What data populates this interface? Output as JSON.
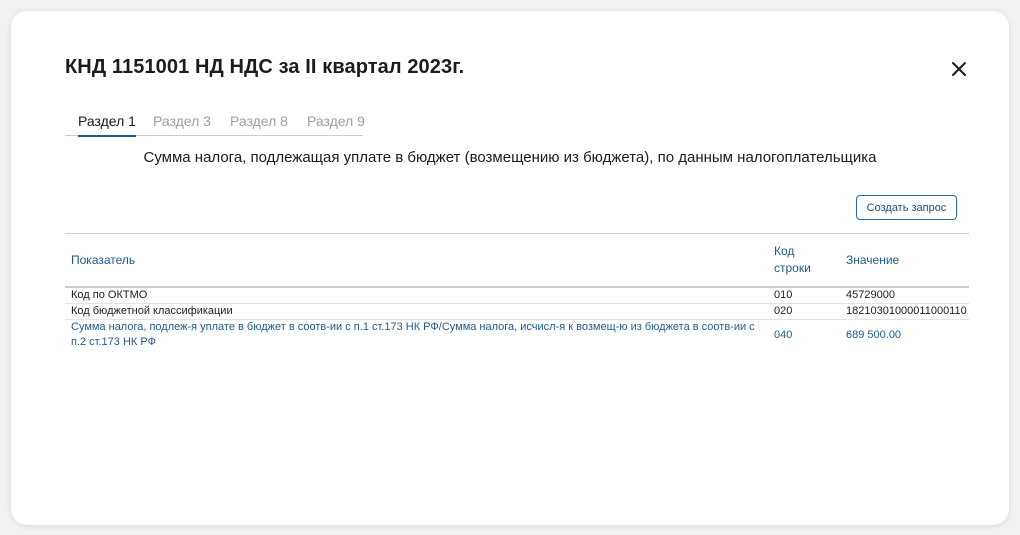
{
  "modal": {
    "title": "КНД 1151001 НД НДС за II квартал 2023г.",
    "close_icon": "close-icon"
  },
  "tabs": [
    {
      "label": "Раздел 1",
      "active": true
    },
    {
      "label": "Раздел 3",
      "active": false
    },
    {
      "label": "Раздел 8",
      "active": false
    },
    {
      "label": "Раздел 9",
      "active": false
    }
  ],
  "section": {
    "heading": "Сумма налога, подлежащая уплате в бюджет (возмещению из бюджета), по данным налогоплательщика"
  },
  "toolbar": {
    "create_request_label": "Создать запрос"
  },
  "table": {
    "headers": {
      "indicator": "Показатель",
      "line_code_1": "Код",
      "line_code_2": "строки",
      "value": "Значение"
    },
    "rows": [
      {
        "indicator": "Код по ОКТМО",
        "code": "010",
        "value": "45729000"
      },
      {
        "indicator": "Код бюджетной классификации",
        "code": "020",
        "value": "18210301000011000110"
      },
      {
        "indicator": "Сумма налога, подлеж-я уплате в бюджет в соотв-ии с п.1 ст.173 НК РФ/Сумма налога, исчисл-я к возмещ-ю из бюджета в соотв-ии с п.2 ст.173 НК РФ",
        "code": "040",
        "value": "689 500.00"
      }
    ]
  },
  "colors": {
    "accent": "#1f5a8e",
    "text": "#1c1c1c",
    "muted": "#9a9ea5",
    "divider": "#c9ccd1"
  }
}
